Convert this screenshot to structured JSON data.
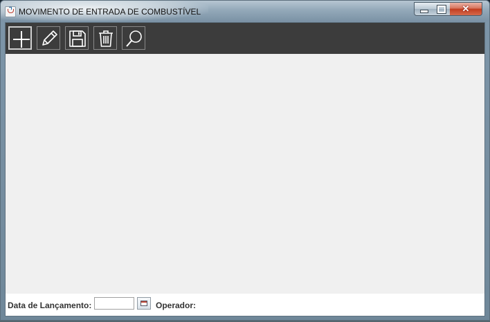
{
  "window": {
    "title": "MOVIMENTO DE ENTRADA DE COMBUSTÍVEL",
    "controls": {
      "minimize": "minimize",
      "maximize": "maximize",
      "close": "✕"
    }
  },
  "toolbar": {
    "buttons": [
      {
        "name": "add",
        "icon": "plus-icon"
      },
      {
        "name": "edit",
        "icon": "pencil-icon"
      },
      {
        "name": "save",
        "icon": "floppy-disk-icon"
      },
      {
        "name": "delete",
        "icon": "trash-icon"
      },
      {
        "name": "search",
        "icon": "magnifier-icon"
      }
    ]
  },
  "footer": {
    "date_label": "Data de Lançamento:",
    "date_value": "",
    "operator_label": "Operador:",
    "operator_value": ""
  },
  "colors": {
    "toolbar_bg": "#3c3c3c",
    "content_bg": "#f0f0f0",
    "footer_bg": "#ffffff",
    "icon_stroke": "#ffffff"
  }
}
